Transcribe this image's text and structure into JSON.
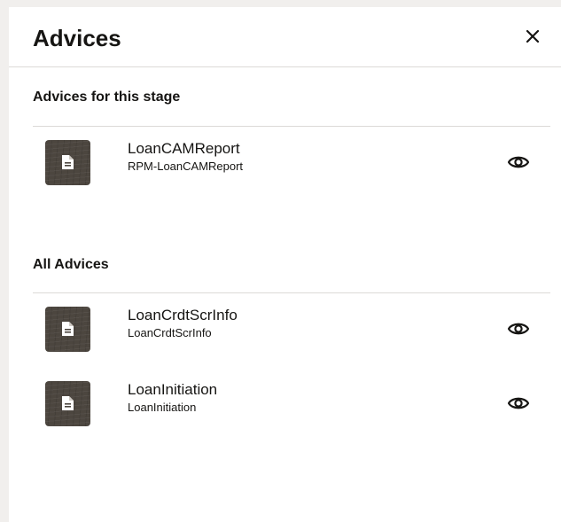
{
  "panel": {
    "title": "Advices",
    "close_icon": "close-icon"
  },
  "stage_section": {
    "heading": "Advices for this stage",
    "items": [
      {
        "name": "LoanCAMReport",
        "code": "RPM-LoanCAMReport",
        "icon": "document-icon",
        "action_icon": "eye-icon"
      }
    ]
  },
  "all_section": {
    "heading": "All Advices",
    "items": [
      {
        "name": "LoanCrdtScrInfo",
        "code": "LoanCrdtScrInfo",
        "icon": "document-icon",
        "action_icon": "eye-icon"
      },
      {
        "name": "LoanInitiation",
        "code": "LoanInitiation",
        "icon": "document-icon",
        "action_icon": "eye-icon"
      }
    ]
  },
  "colors": {
    "text": "#161513",
    "divider": "#dcdad7",
    "thumbnail": "#4c463f",
    "page_background": "#f1efed"
  }
}
